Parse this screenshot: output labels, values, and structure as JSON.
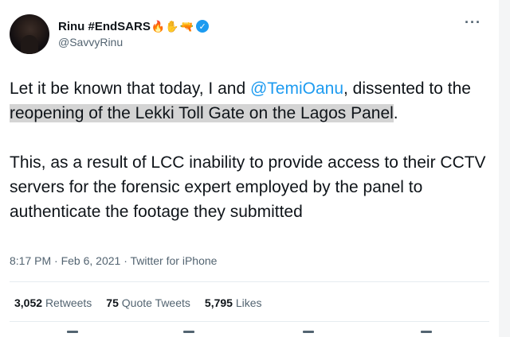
{
  "tweet": {
    "display_name": "Rinu #EndSARS",
    "name_emojis": [
      "🔥✋",
      "🔫"
    ],
    "handle": "@SavvyRinu",
    "more_glyph": "···",
    "paragraph1": {
      "pre": "Let it be known that today, I and ",
      "mention": "@TemiOanu",
      "mid": ", dissented to the ",
      "highlight": "reopening of the Lekki Toll Gate on the Lagos Panel",
      "post": "."
    },
    "paragraph2": "This, as a result of LCC inability to provide access to their CCTV servers for the forensic expert employed by the panel  to authenticate the footage they submitted",
    "meta": "8:17 PM · Feb 6, 2021 · Twitter for iPhone",
    "stats": {
      "retweets_count": "3,052",
      "retweets_label": "Retweets",
      "quotes_count": "75",
      "quotes_label": "Quote Tweets",
      "likes_count": "5,795",
      "likes_label": "Likes"
    }
  },
  "colors": {
    "accent": "#1d9bf0",
    "highlight": "#d4d4d4",
    "secondary_text": "#536471"
  },
  "icons": [
    "verified-badge-icon",
    "more-options-icon",
    "reply-icon",
    "retweet-icon",
    "like-icon",
    "share-icon"
  ]
}
